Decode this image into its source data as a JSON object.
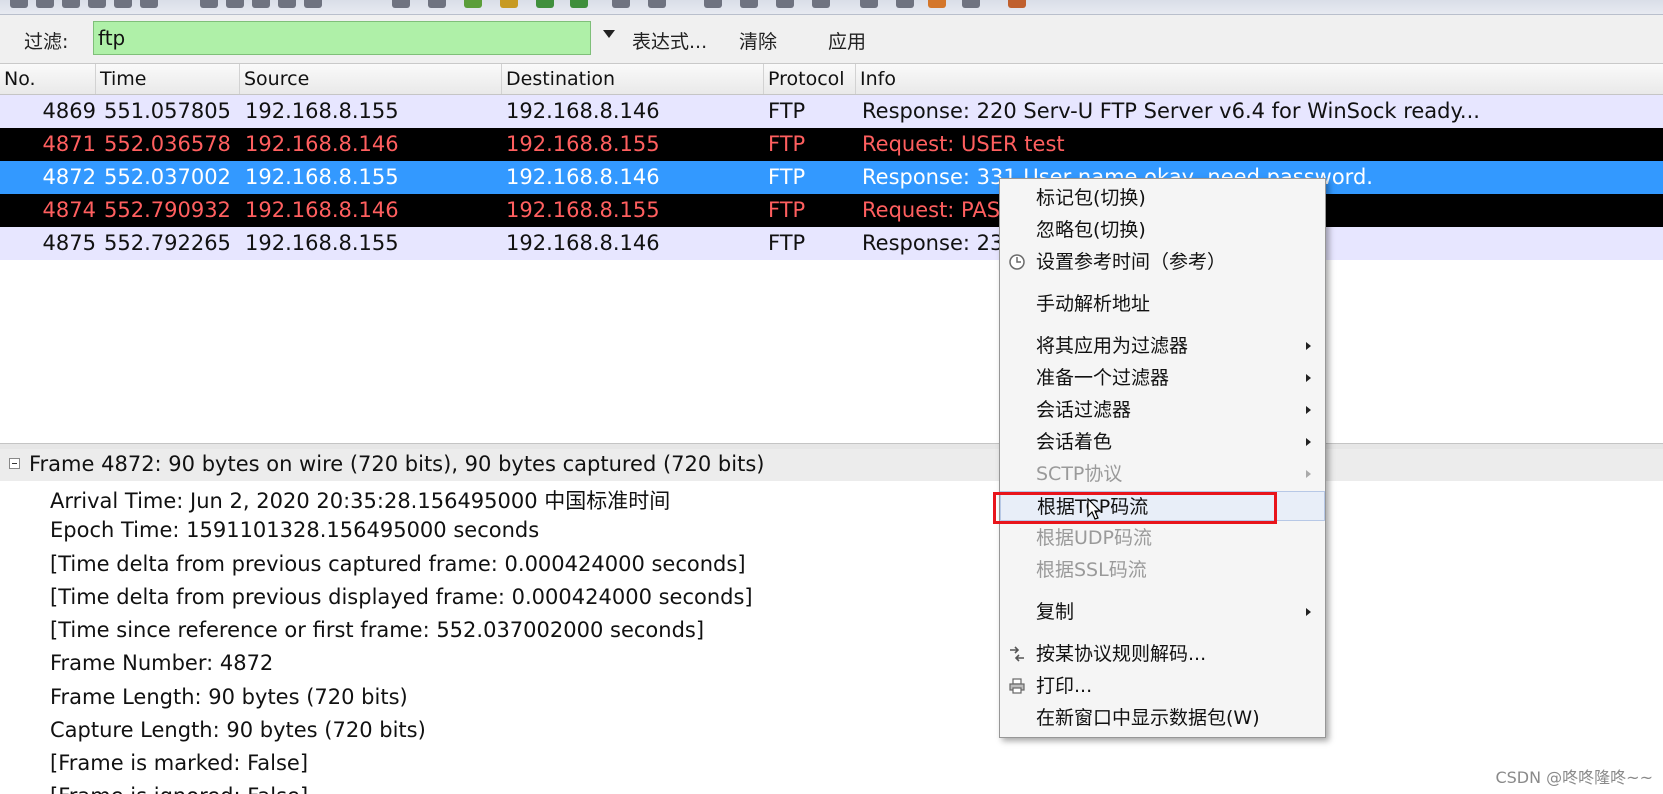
{
  "filter": {
    "label": "过滤:",
    "value": "ftp",
    "expression_button": "表达式...",
    "clear_button": "清除",
    "apply_button": "应用",
    "active_color": "#aff0a8"
  },
  "packet_list": {
    "columns": [
      "No.",
      "Time",
      "Source",
      "Destination",
      "Protocol",
      "Info"
    ],
    "rows": [
      {
        "no": "4869",
        "time": "551.057805",
        "source": "192.168.8.155",
        "destination": "192.168.8.146",
        "protocol": "FTP",
        "info": "Response: 220 Serv-U FTP Server v6.4 for WinSock ready...",
        "style": "response"
      },
      {
        "no": "4871",
        "time": "552.036578",
        "source": "192.168.8.146",
        "destination": "192.168.8.155",
        "protocol": "FTP",
        "info": "Request: USER test",
        "style": "request"
      },
      {
        "no": "4872",
        "time": "552.037002",
        "source": "192.168.8.155",
        "destination": "192.168.8.146",
        "protocol": "FTP",
        "info": "Response: 331 User name okay, need password.",
        "style": "selected"
      },
      {
        "no": "4874",
        "time": "552.790932",
        "source": "192.168.8.146",
        "destination": "192.168.8.155",
        "protocol": "FTP",
        "info": "Request: PAS",
        "style": "request"
      },
      {
        "no": "4875",
        "time": "552.792265",
        "source": "192.168.8.155",
        "destination": "192.168.8.146",
        "protocol": "FTP",
        "info": "Response: 23",
        "style": "response"
      }
    ],
    "colors": {
      "response_bg": "#e7e6ff",
      "request_bg": "#000000",
      "request_fg": "#ff5f5f",
      "selected_bg": "#3399ff",
      "selected_fg": "#ffffff"
    }
  },
  "details": {
    "frame_summary": "Frame 4872: 90 bytes on wire (720 bits), 90 bytes captured (720 bits)",
    "lines": [
      "Arrival Time: Jun  2, 2020 20:35:28.156495000 中国标准时间",
      "Epoch Time: 1591101328.156495000 seconds",
      "[Time delta from previous captured frame: 0.000424000 seconds]",
      "[Time delta from previous displayed frame: 0.000424000 seconds]",
      "[Time since reference or first frame: 552.037002000 seconds]",
      "Frame Number: 4872",
      "Frame Length: 90 bytes (720 bits)",
      "Capture Length: 90 bytes (720 bits)",
      "[Frame is marked: False]",
      "[Frame is ignored: False]"
    ]
  },
  "context_menu": {
    "items": [
      {
        "label": "标记包(切换)",
        "submenu": false,
        "disabled": false,
        "icon": ""
      },
      {
        "label": "忽略包(切换)",
        "submenu": false,
        "disabled": false,
        "icon": ""
      },
      {
        "label": "设置参考时间（参考）",
        "submenu": false,
        "disabled": false,
        "icon": "clock-icon"
      },
      {
        "label": "手动解析地址",
        "submenu": false,
        "disabled": false,
        "icon": ""
      },
      {
        "label": "将其应用为过滤器",
        "submenu": true,
        "disabled": false,
        "icon": ""
      },
      {
        "label": "准备一个过滤器",
        "submenu": true,
        "disabled": false,
        "icon": ""
      },
      {
        "label": "会话过滤器",
        "submenu": true,
        "disabled": false,
        "icon": ""
      },
      {
        "label": "会话着色",
        "submenu": true,
        "disabled": false,
        "icon": ""
      },
      {
        "label": "SCTP协议",
        "submenu": true,
        "disabled": true,
        "icon": ""
      },
      {
        "label": "根据TCP码流",
        "submenu": false,
        "disabled": false,
        "icon": "",
        "highlighted": true
      },
      {
        "label": "根据UDP码流",
        "submenu": false,
        "disabled": true,
        "icon": ""
      },
      {
        "label": "根据SSL码流",
        "submenu": false,
        "disabled": true,
        "icon": ""
      },
      {
        "label": "复制",
        "submenu": true,
        "disabled": false,
        "icon": ""
      },
      {
        "label": "按某协议规则解码...",
        "submenu": false,
        "disabled": false,
        "icon": "decode-icon"
      },
      {
        "label": "打印...",
        "submenu": false,
        "disabled": false,
        "icon": "printer-icon"
      },
      {
        "label": "在新窗口中显示数据包(W)",
        "submenu": false,
        "disabled": false,
        "icon": ""
      }
    ],
    "highlight_color": "#e8141b"
  },
  "watermark": "CSDN @咚咚隆咚~~"
}
